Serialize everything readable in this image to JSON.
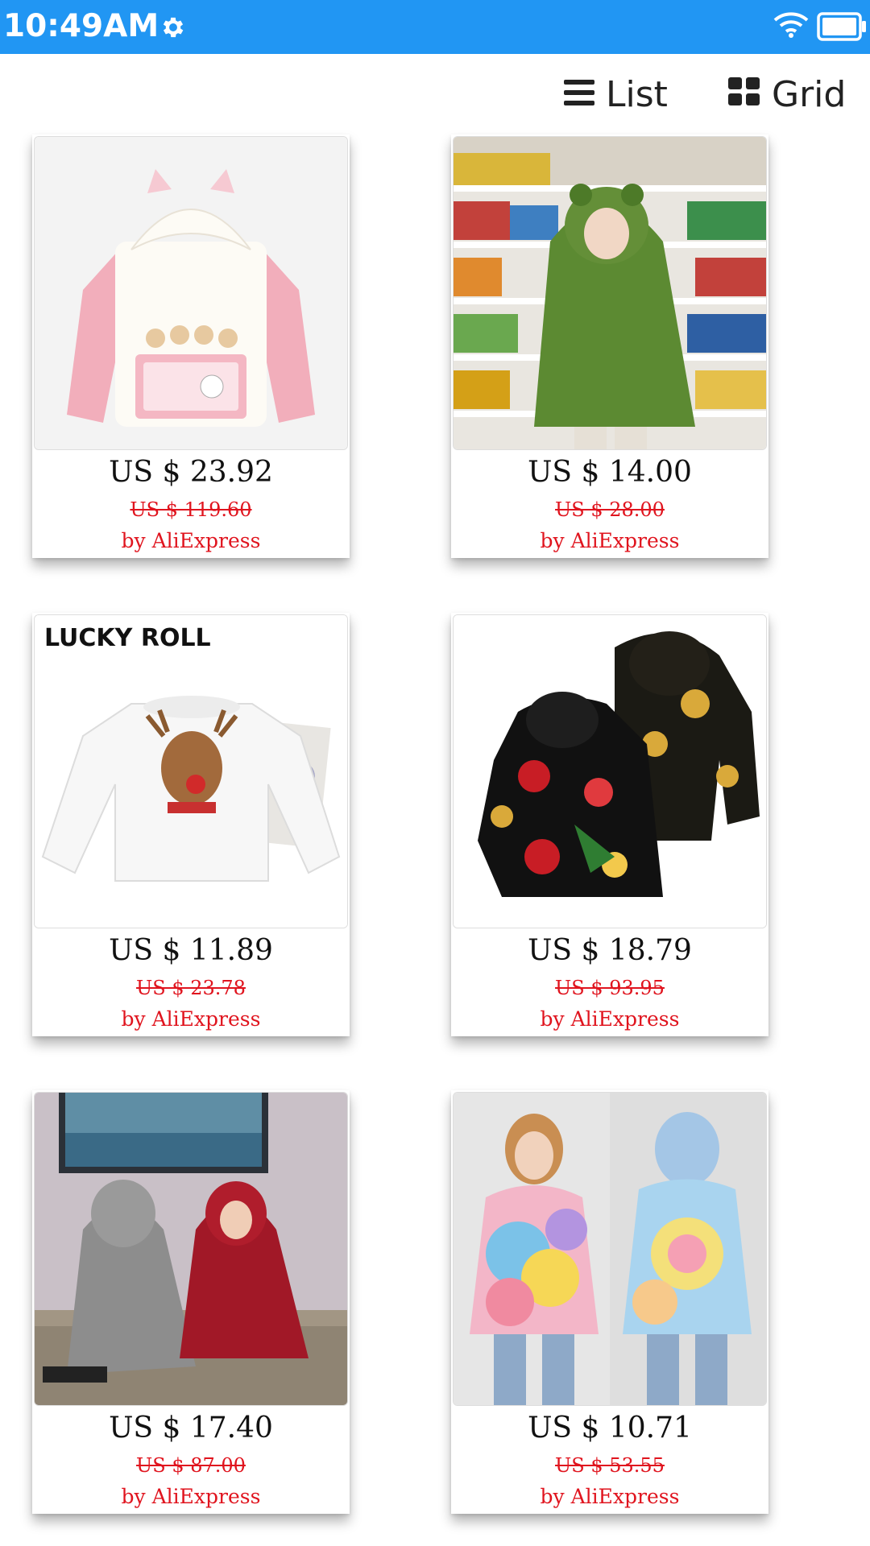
{
  "status_bar": {
    "time": "10:49AM",
    "icons": [
      "gear-icon",
      "wifi-icon",
      "battery-icon"
    ],
    "color": "#2196f3"
  },
  "view_toggle": {
    "list_label": "List",
    "grid_label": "Grid",
    "list_icon": "list-icon",
    "grid_icon": "grid-icon"
  },
  "products": [
    {
      "price": "US $ 23.92",
      "original_price": "US $ 119.60",
      "seller": "by AliExpress",
      "image": "pink-white-cat-ear-hoodie"
    },
    {
      "price": "US $ 14.00",
      "original_price": "US $ 28.00",
      "seller": "by AliExpress",
      "image": "green-frog-hoodie-store"
    },
    {
      "price": "US $ 11.89",
      "original_price": "US $ 23.78",
      "seller": "by AliExpress",
      "image": "white-reindeer-sweatshirt",
      "image_text": "LUCKY ROLL"
    },
    {
      "price": "US $ 18.79",
      "original_price": "US $ 93.95",
      "seller": "by AliExpress",
      "image": "black-floral-turtle-hoodie"
    },
    {
      "price": "US $ 17.40",
      "original_price": "US $ 87.00",
      "seller": "by AliExpress",
      "image": "grey-red-blanket-hoodies"
    },
    {
      "price": "US $ 10.71",
      "original_price": "US $ 53.55",
      "seller": "by AliExpress",
      "image": "tie-dye-hoodie"
    }
  ],
  "colors": {
    "accent": "#2196f3",
    "discount_red": "#e0141e"
  }
}
